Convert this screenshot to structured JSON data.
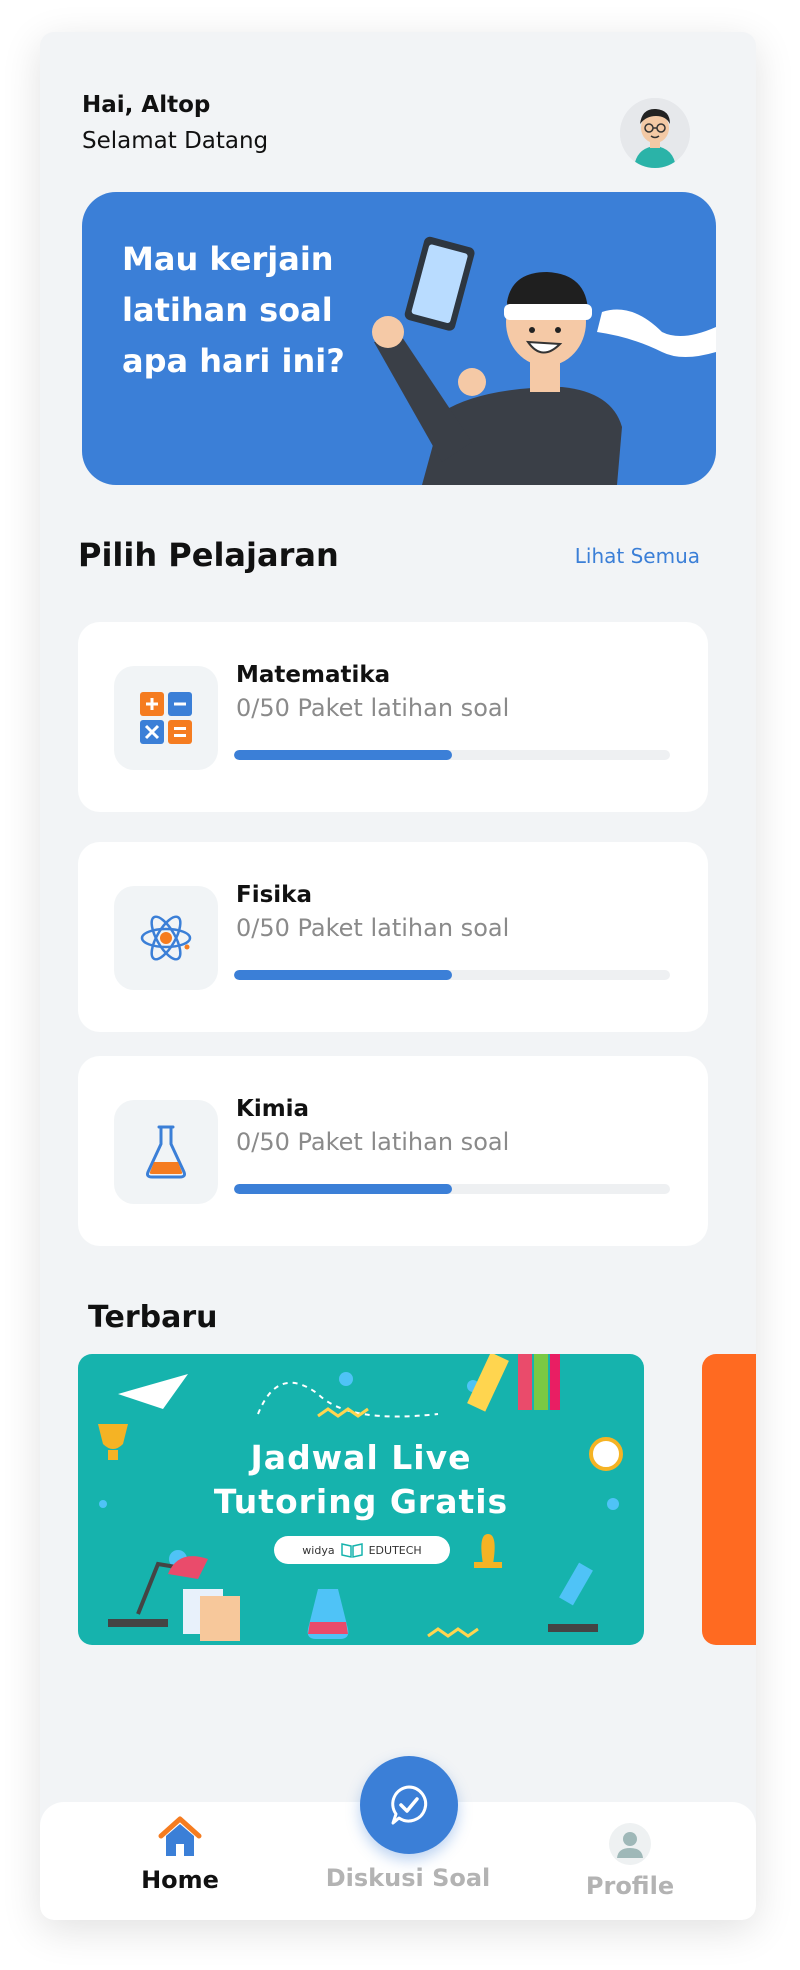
{
  "header": {
    "greeting": "Hai, Altop",
    "welcome": "Selamat Datang"
  },
  "hero": {
    "text": "Mau kerjain latihan soal apa hari ini?"
  },
  "subjects_section": {
    "title": "Pilih Pelajaran",
    "see_all": "Lihat Semua"
  },
  "subjects": [
    {
      "name": "Matematika",
      "subtitle": "0/50 Paket latihan soal",
      "progress": 0.5,
      "icon": "calculator-icon"
    },
    {
      "name": "Fisika",
      "subtitle": "0/50 Paket latihan soal",
      "progress": 0.5,
      "icon": "atom-icon"
    },
    {
      "name": "Kimia",
      "subtitle": "0/50 Paket latihan soal",
      "progress": 0.5,
      "icon": "flask-icon"
    }
  ],
  "latest": {
    "title": "Terbaru",
    "banner": {
      "line1": "Jadwal Live",
      "line2": "Tutoring Gratis",
      "brand_left": "widya",
      "brand_right": "EDUTECH"
    }
  },
  "nav": {
    "home": "Home",
    "discuss": "Diskusi Soal",
    "profile": "Profile"
  },
  "colors": {
    "accent": "#3b7fd7",
    "orange": "#ff6a21",
    "teal": "#16b3ad"
  }
}
